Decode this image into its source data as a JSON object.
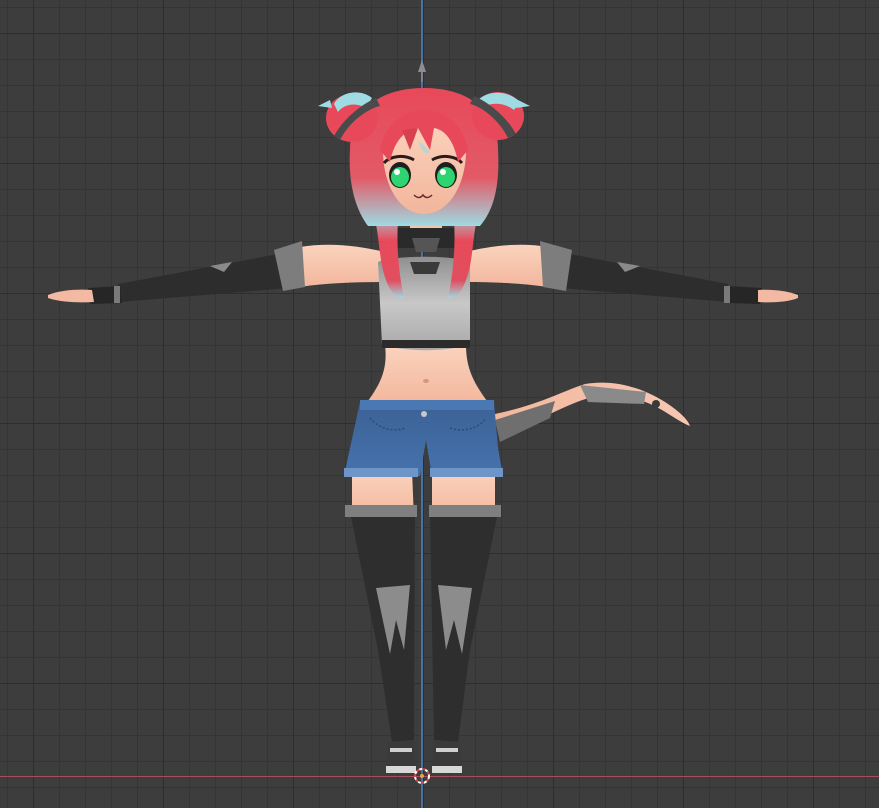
{
  "viewport": {
    "background_color": "#3d3d3d",
    "grid_color": "#2e2e2e",
    "axis_z_color": "#4a7ab8",
    "axis_x_color": "#b8505a"
  },
  "model": {
    "skin_color": "#f6c2a8",
    "hair_color": "#e8495a",
    "hair_tip_color": "#9fdbe3",
    "eye_color": "#2dd46f",
    "top_color": "#b9b9b9",
    "shorts_color": "#3f6aa3",
    "stocking_color": "#2e2e2e",
    "glove_color": "#2a2a2a"
  },
  "icons": {
    "cursor": "3d-cursor-icon",
    "marker": "empty-object-icon"
  }
}
